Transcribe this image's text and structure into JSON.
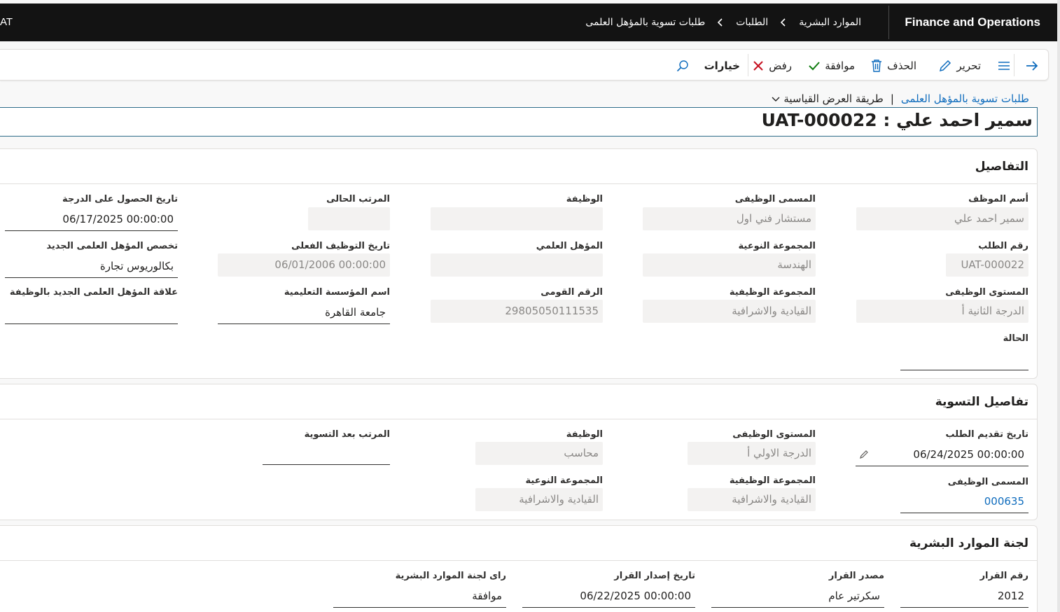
{
  "app": {
    "title": "Finance and Operations",
    "env": "AT",
    "breadcrumbs": [
      "الموارد البشرية",
      "الطلبات",
      "طلبات تسوية بالمؤهل العلمى"
    ]
  },
  "toolbar": {
    "edit_label": "تحرير",
    "delete_label": "الحذف",
    "approve_label": "موافقة",
    "reject_label": "رفض",
    "options_label": "خيارات"
  },
  "form": {
    "crumb_link": "طلبات تسوية بالمؤهل العلمى",
    "separator": "|",
    "view_label": "طريقة العرض القياسية",
    "title": "سمير احمد علي : UAT-000022"
  },
  "details": {
    "heading": "التفاصيل",
    "employee_name": {
      "label": "أسم الموظف",
      "value": "سمير احمد علي"
    },
    "request_number": {
      "label": "رقم الطلب",
      "value": "UAT-000022"
    },
    "job_level": {
      "label": "المستوى الوظيفى",
      "value": "الدرجة الثانية أ"
    },
    "status": {
      "label": "الحالة",
      "value": ""
    },
    "job_title": {
      "label": "المسمى الوظيفى",
      "value": "مستشار فني اول"
    },
    "qualitative_group": {
      "label": "المجموعة النوعية",
      "value": "الهندسة"
    },
    "job_group": {
      "label": "المجموعة الوظيفية",
      "value": "القيادية والاشرافية"
    },
    "position": {
      "label": "الوظيفة",
      "value": ""
    },
    "qualification": {
      "label": "المؤهل العلمي",
      "value": ""
    },
    "national_id": {
      "label": "الرقم القومى",
      "value": "29805050111535"
    },
    "current_salary": {
      "label": "المرتب الحالى",
      "value": ""
    },
    "hire_date": {
      "label": "تاريخ التوظيف الفعلى",
      "value": "06/01/2006 00:00:00"
    },
    "institution": {
      "label": "اسم المؤسسة التعليمية",
      "value": "جامعة القاهرة"
    },
    "degree_date": {
      "label": "تاريخ الحصول على الدرجة",
      "value": "06/17/2025 00:00:00"
    },
    "new_specialization": {
      "label": "تخصص المؤهل العلمى الجديد",
      "value": "بكالوريوس تجارة"
    },
    "relation": {
      "label": "علاقة المؤهل العلمى الجديد بالوظيفة",
      "value": ""
    }
  },
  "settlement": {
    "heading": "تفاصيل التسوية",
    "submit_date": {
      "label": "تاريخ تقديم الطلب",
      "value": "06/24/2025 00:00:00"
    },
    "job_title": {
      "label": "المسمى الوظيفى",
      "value": "000635"
    },
    "job_level": {
      "label": "المستوى الوظيفى",
      "value": "الدرجة الاولي أ"
    },
    "job_group": {
      "label": "المجموعة الوظيفية",
      "value": "القيادية والاشرافية"
    },
    "position": {
      "label": "الوظيفة",
      "value": "محاسب"
    },
    "qualitative_group": {
      "label": "المجموعة النوعية",
      "value": "القيادية والاشرافية"
    },
    "salary_after": {
      "label": "المرتب بعد التسوية",
      "value": ""
    }
  },
  "committee": {
    "heading": "لجنة الموارد البشرية",
    "decision_number": {
      "label": "رقم القرار",
      "value": "2012"
    },
    "decision_source": {
      "label": "مصدر القرار",
      "value": "سكرتير عام"
    },
    "decision_date": {
      "label": "تاريخ إصدار القرار",
      "value": "06/22/2025 00:00:00"
    },
    "committee_opinion": {
      "label": "راى لجنة الموارد البشرية",
      "value": "موافقة"
    }
  },
  "colors": {
    "topbar": "#131313",
    "link": "#0f6cbd",
    "approve": "#107c10",
    "reject": "#c50f1f",
    "title_border": "#2f6d8a"
  }
}
